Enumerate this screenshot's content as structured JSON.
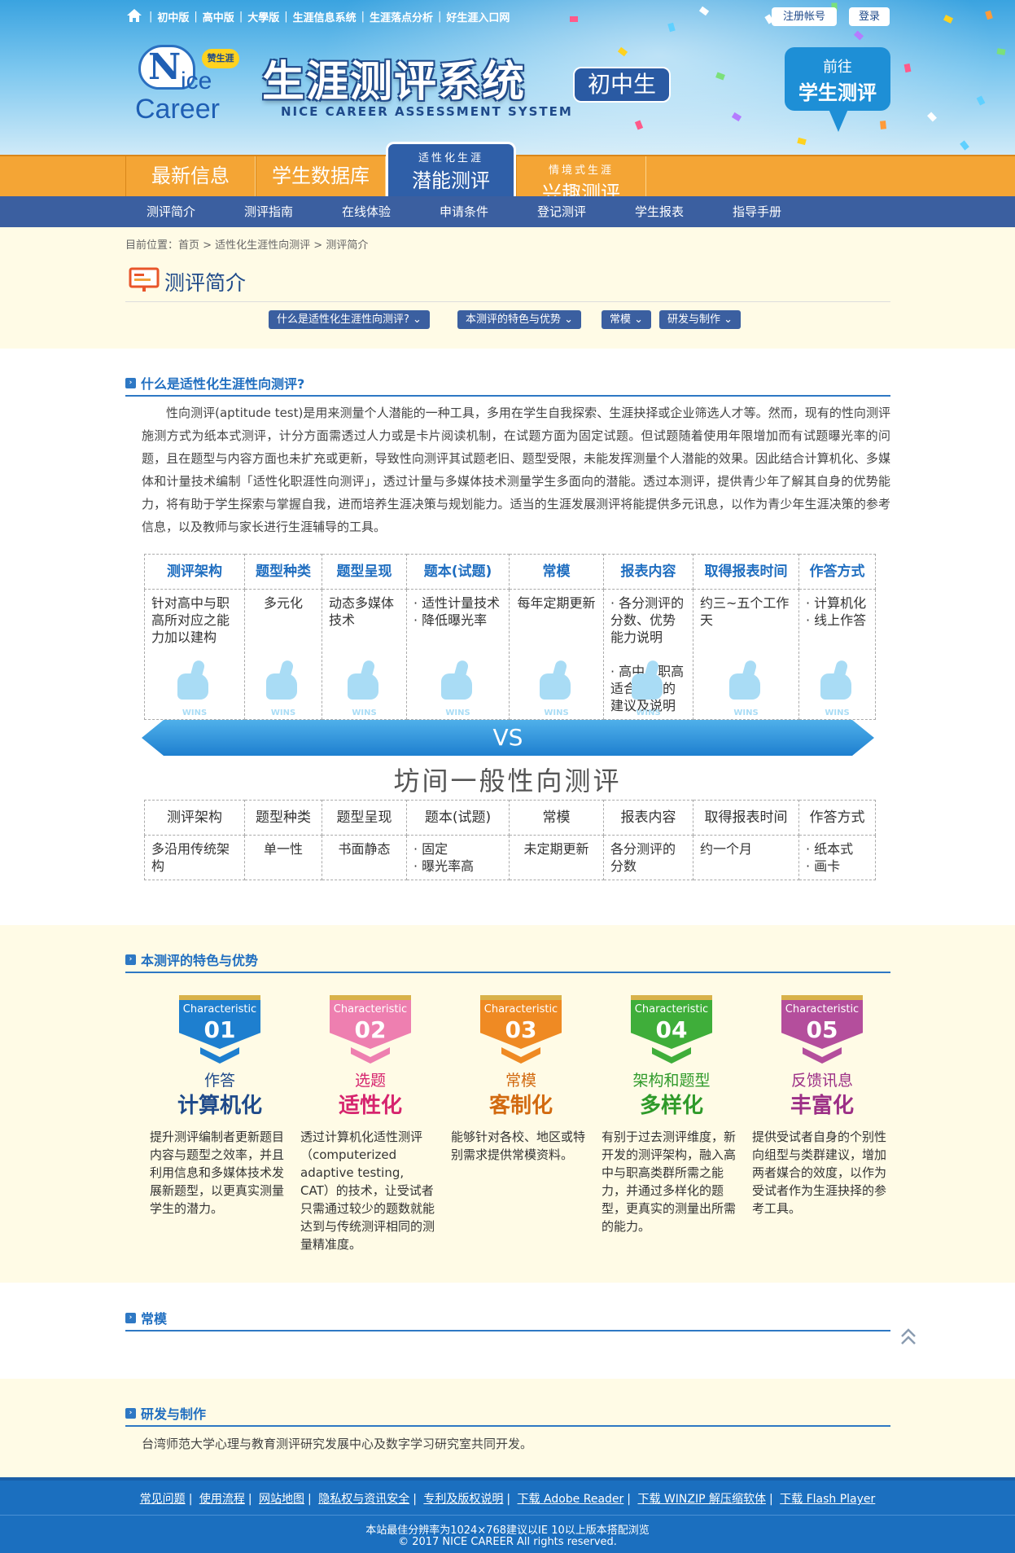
{
  "top_nav": {
    "links": [
      "初中版",
      "高中版",
      "大學版",
      "生涯信息系统",
      "生涯落点分析",
      "好生涯入口网"
    ],
    "register": "注册帐号",
    "login": "登录"
  },
  "logo": {
    "badge": "赞生涯",
    "word1": "N",
    "word2": "ice",
    "word3": "Career"
  },
  "header": {
    "title": "生涯测评系统",
    "subtitle": "NICE CAREER ASSESSMENT SYSTEM",
    "level": "初中生",
    "goto_line1": "前往",
    "goto_line2": "学生测评"
  },
  "main_tabs": [
    {
      "label": "最新信息"
    },
    {
      "label": "学生数据库"
    },
    {
      "small": "适性化生涯",
      "label": "潜能测评"
    },
    {
      "small": "情境式生涯",
      "label": "兴趣测评"
    }
  ],
  "sub_nav": [
    "测评简介",
    "测评指南",
    "在线体验",
    "申请条件",
    "登记测评",
    "学生报表",
    "指导手册"
  ],
  "breadcrumb": "目前位置：首页 > 适性化生涯性向测评 > 测评简介",
  "page_title": "测评简介",
  "anchors": [
    "什么是适性化生涯性向测评?",
    "本测评的特色与优势",
    "常模",
    "研发与制作"
  ],
  "section1": {
    "heading": "什么是适性化生涯性向测评?",
    "intro": "性向测评(aptitude test)是用来测量个人潜能的一种工具，多用在学生自我探索、生涯抉择或企业筛选人才等。然而，现有的性向测评施测方式为纸本式测评，计分方面需透过人力或是卡片阅读机制，在试题方面为固定试题。但试题随着使用年限增加而有试题曝光率的问题，且在题型与内容方面也未扩充或更新，导致性向测评其试题老旧、题型受限，未能发挥测量个人潜能的效果。因此结合计算机化、多媒体和计量技术编制「适性化职涯性向测评」，透过计量与多媒体技术测量学生多面向的潜能。透过本测评，提供青少年了解其自身的优势能力，将有助于学生探索与掌握自我，进而培养生涯决策与规划能力。适当的生涯发展测评将能提供多元讯息，以作为青少年生涯决策的参考信息，以及教师与家长进行生涯辅导的工具。"
  },
  "table_headers": [
    "测评架构",
    "题型种类",
    "题型呈现",
    "题本(试题)",
    "常模",
    "报表内容",
    "取得报表时间",
    "作答方式"
  ],
  "table_top_cells": [
    "针对高中与职高所对应之能力加以建构",
    "多元化",
    "动态多媒体技术",
    "· 适性计量技术\n· 降低曝光率",
    "每年定期更新",
    "· 各分测评的分数、优势能力说明\n\n· 高中与职高适合发展的建议及说明",
    "约三~五个工作天",
    "· 计算机化\n· 线上作答"
  ],
  "wins_label": "WINS",
  "vs_label": "VS",
  "vs_title": "坊间一般性向测评",
  "table_bottom_cells": [
    "多沿用传统架构",
    "单一性",
    "书面静态",
    "· 固定\n· 曝光率高",
    "未定期更新",
    "各分测评的分数",
    "约一个月",
    "· 纸本式\n· 画卡"
  ],
  "section2": {
    "heading": "本测评的特色与优势",
    "badge_text": "Characteristic",
    "items": [
      {
        "num": "01",
        "t1": "作答",
        "t2": "计算机化",
        "desc": "提升测评编制者更新题目内容与题型之效率，并且利用信息和多媒体技术发展新题型，以更真实测量学生的潜力。",
        "color": "#1e7fcf",
        "title_color": "#1f4a8a"
      },
      {
        "num": "02",
        "t1": "选题",
        "t2": "适性化",
        "desc": "透过计算机化适性测评（computerized adaptive testing, CAT）的技术，让受试者只需通过较少的题数就能达到与传统测评相同的测量精准度。",
        "color": "#ee7fb0",
        "title_color": "#d6246e"
      },
      {
        "num": "03",
        "t1": "常模",
        "t2": "客制化",
        "desc": "能够针对各校、地区或特别需求提供常模资料。",
        "color": "#ef8a23",
        "title_color": "#d26a10"
      },
      {
        "num": "04",
        "t1": "架构和题型",
        "t2": "多样化",
        "desc": "有别于过去测评维度，新开发的测评架构，融入高中与职高类群所需之能力，并通过多样化的题型，更真实的测量出所需的能力。",
        "color": "#3fae3a",
        "title_color": "#2f9a2a"
      },
      {
        "num": "05",
        "t1": "反馈讯息",
        "t2": "丰富化",
        "desc": "提供受试者自身的个别性向组型与类群建议，增加两者媒合的效度，以作为受试者作为生涯抉择的参考工具。",
        "color": "#b44e9c",
        "title_color": "#9c2f86"
      }
    ]
  },
  "section3": {
    "heading": "常模"
  },
  "section4": {
    "heading": "研发与制作",
    "text": "台湾师范大学心理与教育测评研究发展中心及数字学习研究室共同开发。"
  },
  "footer": {
    "links": [
      "常见问题",
      "使用流程",
      "网站地图",
      "隐私权与资讯安全",
      "专利及版权说明",
      "下载 Adobe Reader",
      "下载 WINZIP 解压缩软体",
      "下载 Flash Player"
    ],
    "line1": "本站最佳分辨率为1024×768建议以IE 10以上版本搭配浏览",
    "line2": "© 2017 NICE CAREER All rights reserved."
  }
}
